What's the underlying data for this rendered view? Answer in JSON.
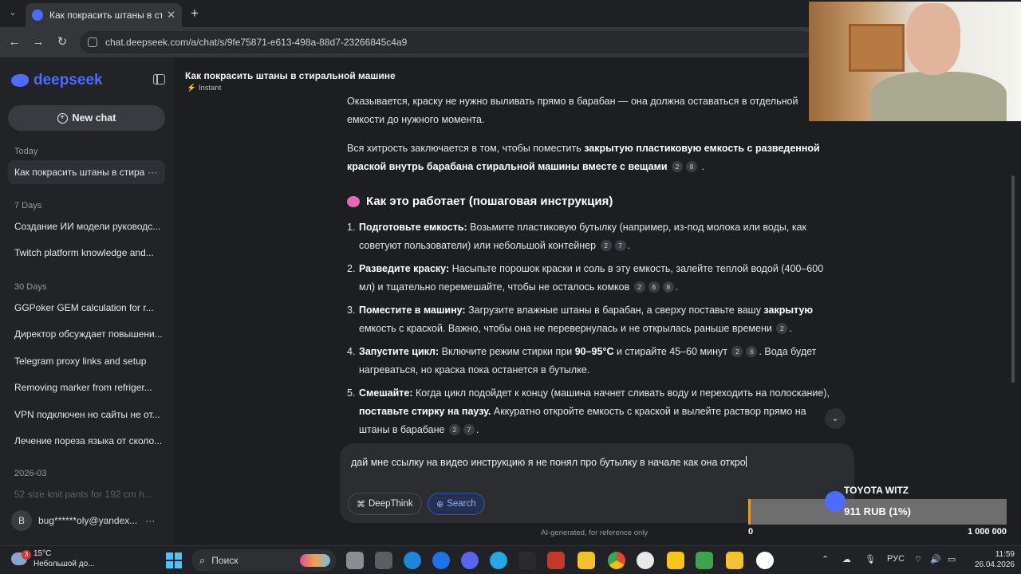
{
  "browser": {
    "tab_title": "Как покрасить штаны в стирал",
    "tab_close": "✕",
    "new_tab": "+",
    "url": "chat.deepseek.com/a/chat/s/9fe75871-e613-498a-88d7-23266845c4a9"
  },
  "sidebar": {
    "logo_text": "deepseek",
    "new_chat_label": "New chat",
    "sections": {
      "today": "Today",
      "seven_days": "7 Days",
      "thirty_days": "30 Days",
      "month": "2026-03"
    },
    "today_items": [
      "Как покрасить штаны в стира"
    ],
    "seven_day_items": [
      "Создание ИИ модели руководс...",
      "Twitch platform knowledge and..."
    ],
    "thirty_day_items": [
      "GGPoker GEM calculation for r...",
      "Директор обсуждает повышени...",
      "Telegram proxy links and setup",
      "Removing marker from refriger...",
      "VPN подключен но сайты не от...",
      "Лечение пореза языка от сколо..."
    ],
    "month_items": [
      "52 size knit pants for 192 cm h..."
    ],
    "item_menu": "···",
    "user_initial": "B",
    "user_email": "bug******oly@yandex..."
  },
  "chat": {
    "title": "Как покрасить штаны в стиральной машине",
    "mode": "Instant",
    "p1": "Оказывается, краску не нужно выливать прямо в барабан — она должна оставаться в отдельной емкости до нужного момента.",
    "p2_a": "Вся хитрость заключается в том, чтобы поместить ",
    "p2_b": "закрытую пластиковую емкость с разведенной краской внутрь барабана стиральной машины вместе с вещами",
    "p2_c1": "2",
    "p2_c2": "8",
    "heading": "Как это работает (пошаговая инструкция)",
    "steps": [
      {
        "num": "1.",
        "bold": "Подготовьте емкость:",
        "text": " Возьмите пластиковую бутылку (например, из-под молока или воды, как советуют пользователи) или небольшой контейнер",
        "cites": [
          "2",
          "7"
        ]
      },
      {
        "num": "2.",
        "bold": "Разведите краску:",
        "text": " Насыпьте порошок краски и соль в эту емкость, залейте теплой водой (400–600 мл) и тщательно перемешайте, чтобы не осталось комков",
        "cites": [
          "2",
          "6",
          "8"
        ]
      },
      {
        "num": "3.",
        "bold": "Поместите в машину:",
        "text": " Загрузите влажные штаны в барабан, а сверху поставьте вашу ",
        "bold2": "закрытую",
        "text2": " емкость с краской. Важно, чтобы она не перевернулась и не открылась раньше времени",
        "cites": [
          "2"
        ]
      },
      {
        "num": "4.",
        "bold": "Запустите цикл:",
        "text": " Включите режим стирки при ",
        "bold2": "90–95°C",
        "text2": " и стирайте 45–60 минут",
        "cites": [
          "2",
          "6"
        ],
        "tail": ". Вода будет нагреваться, но краска пока останется в бутылке."
      },
      {
        "num": "5.",
        "bold": "Смешайте:",
        "text": " Когда цикл подойдет к концу (машина начнет сливать воду и переходить на полоскание), ",
        "bold2": "поставьте стирку на паузу.",
        "text2": " Аккуратно откройте емкость с краской и вылейте раствор прямо на штаны в барабане",
        "cites": [
          "2",
          "7"
        ]
      }
    ],
    "input_value": "дай мне ссылку на видео инструкцию я не понял про бутылку в начале как она откро",
    "deepthink_label": "DeepThink",
    "search_label": "Search",
    "disclaimer": "AI-generated, for reference only"
  },
  "donation": {
    "title": "TOYOTA WITZ",
    "amount_text": "911 RUB (1%)",
    "progress_percent": 1,
    "min_label": "0",
    "max_label": "1 000 000"
  },
  "taskbar": {
    "weather_badge": "3",
    "temperature": "15°C",
    "weather_desc": "Небольшой до...",
    "search_label": "Поиск",
    "language": "РУС",
    "time": "11:59",
    "date": "26.04.2026"
  },
  "colors": {
    "accent": "#4d6bfe",
    "progress_fill": "#e39b2d"
  }
}
